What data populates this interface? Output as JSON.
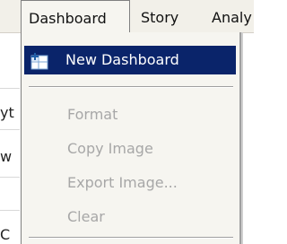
{
  "menubar": {
    "items": [
      {
        "label": "Dashboard"
      },
      {
        "label": "Story"
      },
      {
        "label": "Analy"
      }
    ]
  },
  "background": {
    "fragments": [
      "yt",
      "w",
      "C"
    ]
  },
  "dashboard_menu": {
    "items": [
      {
        "label": "New Dashboard",
        "icon": "new-dashboard-icon",
        "enabled": true,
        "highlighted": true
      },
      {
        "label": "Format",
        "enabled": false
      },
      {
        "label": "Copy Image",
        "enabled": false
      },
      {
        "label": "Export Image...",
        "enabled": false
      },
      {
        "label": "Clear",
        "enabled": false
      }
    ]
  },
  "colors": {
    "highlight": "#0a246a",
    "disabled_text": "#a7a7a7",
    "menu_background": "#f6f5f0"
  }
}
